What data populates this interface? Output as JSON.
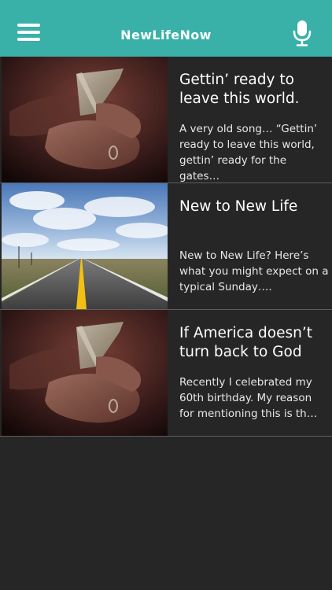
{
  "header": {
    "title": "NewLifeNow",
    "menu_icon": "hamburger-menu-icon",
    "mic_icon": "microphone-icon",
    "color": "#39b1a9"
  },
  "posts": [
    {
      "title": "Gettin’ ready to leave this world.",
      "excerpt": "A very old song… “Gettin’ ready to leave this world, gettin’ ready for the gates…",
      "image": "hands-holding-bible"
    },
    {
      "title": "New to New Life",
      "excerpt": "New to New Life? Here’s what you might expect on a typical Sunday….",
      "image": "open-road"
    },
    {
      "title": "If America doesn’t turn back to God",
      "excerpt": "Recently I celebrated my 60th birthday. My reason for mentioning this is th…",
      "image": "hands-holding-bible"
    }
  ]
}
